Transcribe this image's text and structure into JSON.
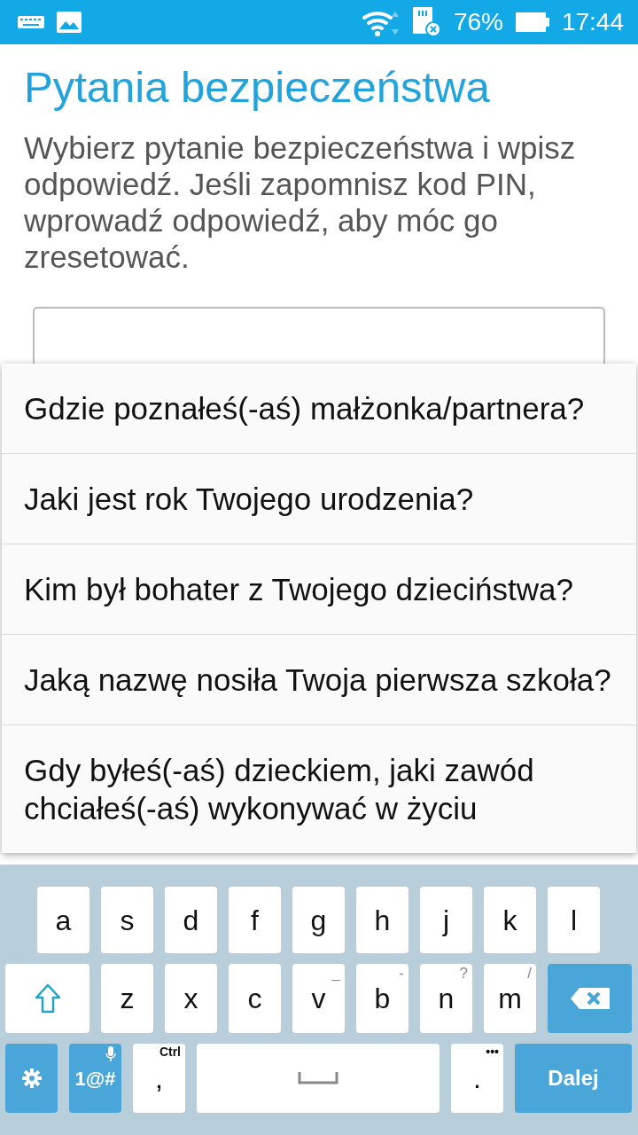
{
  "status_bar": {
    "battery": "76%",
    "time": "17:44"
  },
  "title": "Pytania bezpieczeństwa",
  "description": "Wybierz pytanie bezpieczeństwa i wpisz odpowiedź. Jeśli zapomnisz kod PIN, wprowadź odpowiedź, aby móc go zresetować.",
  "dropdown": {
    "options": [
      {
        "label": "Gdzie poznałeś(-aś) małżonka/partnera?"
      },
      {
        "label": "Jaki jest rok Twojego urodzenia?"
      },
      {
        "label": "Kim był bohater z Twojego dzieciństwa?"
      },
      {
        "label": "Jaką nazwę nosiła Twoja pierwsza szkoła?"
      },
      {
        "label": "Gdy byłeś(-aś) dzieckiem, jaki zawód chciałeś(-aś) wykonywać w życiu"
      }
    ]
  },
  "keyboard": {
    "letter_row": [
      {
        "kind": "letter",
        "label": "a"
      },
      {
        "kind": "letter",
        "label": "s"
      },
      {
        "kind": "letter",
        "label": "d"
      },
      {
        "kind": "letter",
        "label": "f"
      },
      {
        "kind": "letter",
        "label": "g"
      },
      {
        "kind": "letter",
        "label": "h"
      },
      {
        "kind": "letter",
        "label": "j"
      },
      {
        "kind": "letter",
        "label": "k"
      },
      {
        "kind": "letter",
        "label": "l"
      }
    ],
    "shift_row": [
      {
        "kind": "shift"
      },
      {
        "kind": "letter",
        "label": "z"
      },
      {
        "kind": "letter",
        "label": "x"
      },
      {
        "kind": "letter",
        "label": "c"
      },
      {
        "kind": "letter",
        "label": "v",
        "hint": "_"
      },
      {
        "kind": "letter",
        "label": "b",
        "hint": "-"
      },
      {
        "kind": "letter",
        "label": "n",
        "hint": "?"
      },
      {
        "kind": "letter",
        "label": "m",
        "hint": "/"
      },
      {
        "kind": "backspace"
      }
    ],
    "bottom_row": [
      {
        "kind": "settings"
      },
      {
        "kind": "symbols",
        "label": "1@#"
      },
      {
        "kind": "letter",
        "label": ",",
        "hint": "Ctrl"
      },
      {
        "kind": "space"
      },
      {
        "kind": "letter",
        "label": ".",
        "hint": "•••"
      },
      {
        "kind": "action",
        "label": "Dalej"
      }
    ]
  }
}
